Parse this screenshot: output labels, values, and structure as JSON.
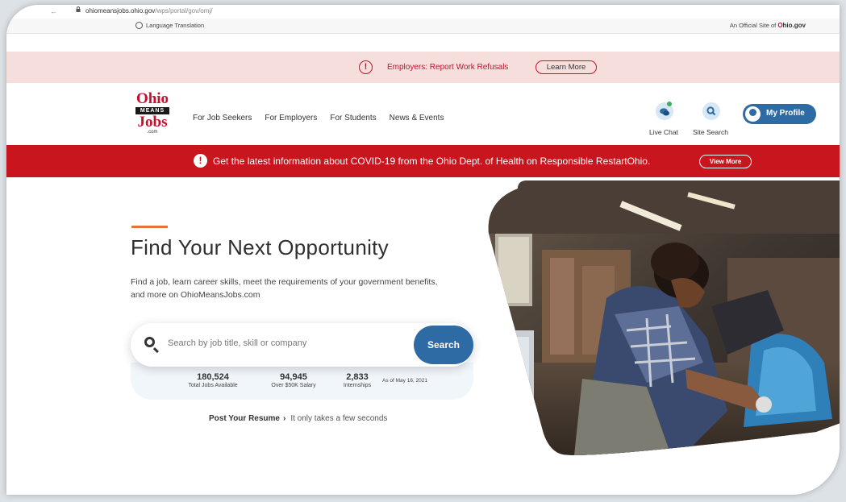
{
  "browser": {
    "url_host": "ohiomeansjobs.ohio.gov",
    "url_path": "/wps/portal/gov/omj/"
  },
  "top_strip": {
    "language": "Language Translation",
    "official_prefix": "An Official Site of",
    "official_brand": "Ohio.gov"
  },
  "alert": {
    "text": "Employers: Report Work Refusals",
    "button": "Learn More"
  },
  "logo": {
    "line1": "Ohio",
    "line2": "MEANS",
    "line3": "Jobs",
    "line4": ".com"
  },
  "nav": [
    "For Job Seekers",
    "For Employers",
    "For Students",
    "News & Events"
  ],
  "header_actions": {
    "live_chat": "Live Chat",
    "site_search": "Site Search",
    "profile": "My Profile"
  },
  "covid": {
    "text": "Get the latest information about COVID-19 from the Ohio Dept. of Health on Responsible RestartOhio.",
    "button": "View More"
  },
  "hero": {
    "title": "Find Your Next Opportunity",
    "description": "Find a job, learn career skills, meet the requirements of your government benefits, and more on OhioMeansJobs.com",
    "search_placeholder": "Search by job title, skill or company",
    "search_button": "Search",
    "stats": [
      {
        "value": "180,524",
        "label": "Total Jobs Available"
      },
      {
        "value": "94,945",
        "label": "Over $50K Salary"
      },
      {
        "value": "2,833",
        "label": "Internships"
      }
    ],
    "as_of": "As of May 16, 2021",
    "resume_link": "Post Your Resume",
    "resume_sub": "It only takes a few seconds"
  },
  "colors": {
    "brand_red": "#c8102e",
    "alert_bg": "#f6dedd",
    "covid_bg": "#c9151e",
    "brand_blue": "#2e6aa3",
    "accent_orange": "#e8713c"
  },
  "icons": [
    "back-arrow-icon",
    "lock-icon",
    "globe-icon",
    "exclamation-icon",
    "chat-icon",
    "search-icon",
    "profile-avatar-icon",
    "magnifier-icon",
    "chevron-right-icon"
  ]
}
